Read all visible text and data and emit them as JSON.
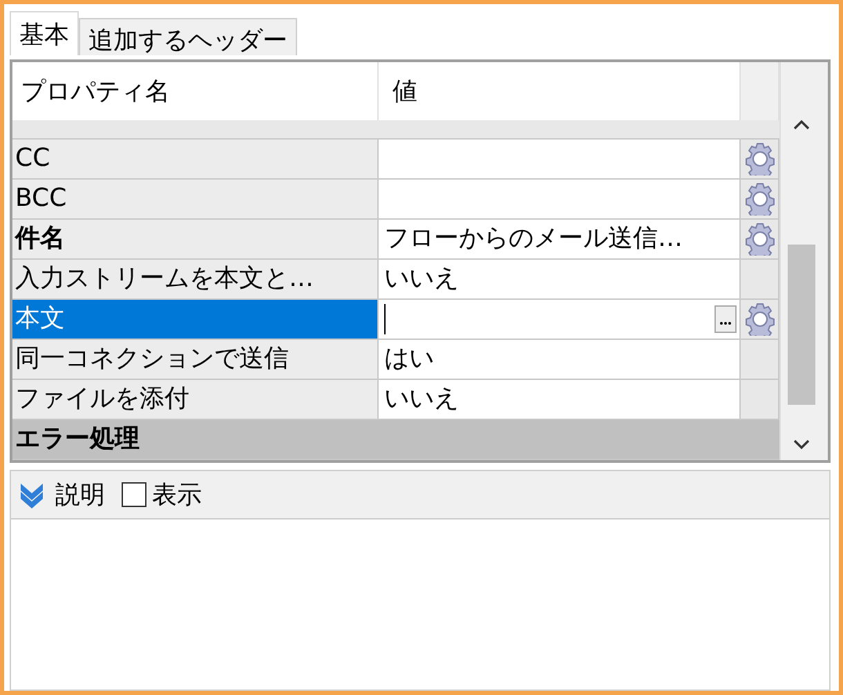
{
  "tabs": [
    {
      "label": "基本",
      "selected": true
    },
    {
      "label": "追加するヘッダー",
      "selected": false
    }
  ],
  "grid": {
    "columns": [
      "プロパティ名",
      "値"
    ],
    "rows": [
      {
        "kind": "property",
        "name": "CC",
        "value": "",
        "bold": false,
        "selected": false,
        "gear": true,
        "ellipsis": false
      },
      {
        "kind": "property",
        "name": "BCC",
        "value": "",
        "bold": false,
        "selected": false,
        "gear": true,
        "ellipsis": false
      },
      {
        "kind": "property",
        "name": "件名",
        "value": "フローからのメール送信…",
        "bold": true,
        "selected": false,
        "gear": true,
        "ellipsis": false
      },
      {
        "kind": "property",
        "name": "入力ストリームを本文と…",
        "value": "いいえ",
        "bold": false,
        "selected": false,
        "gear": false,
        "ellipsis": false
      },
      {
        "kind": "property",
        "name": "本文",
        "value": "",
        "bold": false,
        "selected": true,
        "gear": true,
        "ellipsis": true
      },
      {
        "kind": "property",
        "name": "同一コネクションで送信",
        "value": "はい",
        "bold": false,
        "selected": false,
        "gear": false,
        "ellipsis": false
      },
      {
        "kind": "property",
        "name": "ファイルを添付",
        "value": "いいえ",
        "bold": false,
        "selected": false,
        "gear": false,
        "ellipsis": false
      },
      {
        "kind": "category",
        "name": "エラー処理"
      }
    ]
  },
  "description": {
    "title": "説明",
    "toggle": {
      "label": "表示",
      "checked": false
    }
  }
}
